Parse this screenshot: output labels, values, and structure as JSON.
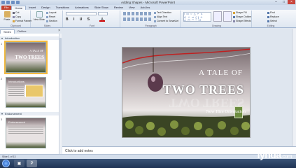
{
  "window": {
    "title": "Adding Shapes - Microsoft PowerPoint"
  },
  "ribbon_tabs": [
    "File",
    "Home",
    "Insert",
    "Design",
    "Transitions",
    "Animations",
    "Slide Show",
    "Review",
    "View",
    "Add-Ins"
  ],
  "ribbon": {
    "clipboard": {
      "paste": "Paste",
      "cut": "Cut",
      "copy": "Copy",
      "format_painter": "Format Painter",
      "label": "Clipboard"
    },
    "slides": {
      "new_slide": "New Slide",
      "layout": "Layout",
      "reset": "Reset",
      "section": "Section",
      "label": "Slides"
    },
    "font": {
      "label": "Font"
    },
    "paragraph": {
      "label": "Paragraph",
      "text_direction": "Text Direction",
      "align_text": "Align Text",
      "convert_smartart": "Convert to SmartArt"
    },
    "drawing": {
      "label": "Drawing",
      "shape_fill": "Shape Fill",
      "shape_outline": "Shape Outline",
      "shape_effects": "Shape Effects"
    },
    "editing": {
      "label": "Editing",
      "find": "Find",
      "replace": "Replace",
      "select": "Select"
    }
  },
  "panel_tabs": [
    "Slides",
    "Outline"
  ],
  "sections": [
    {
      "name": "Introduction"
    },
    {
      "name": "Endorsement"
    }
  ],
  "thumbnails": [
    {
      "num": "1",
      "line1": "A TALE OF",
      "line2": "TWO TREES"
    },
    {
      "num": "2",
      "title": "Introductions"
    },
    {
      "num": "3",
      "title": "Endorsement"
    }
  ],
  "slide": {
    "title_top": "A TALE OF",
    "title_main": "TWO TREES",
    "subtitle": "New Hire Orientation"
  },
  "notes_placeholder": "Click to add notes",
  "status": {
    "text": "Slide 1 of 13"
  },
  "watermark": {
    "brand": "lynda",
    "suffix": ".com"
  }
}
